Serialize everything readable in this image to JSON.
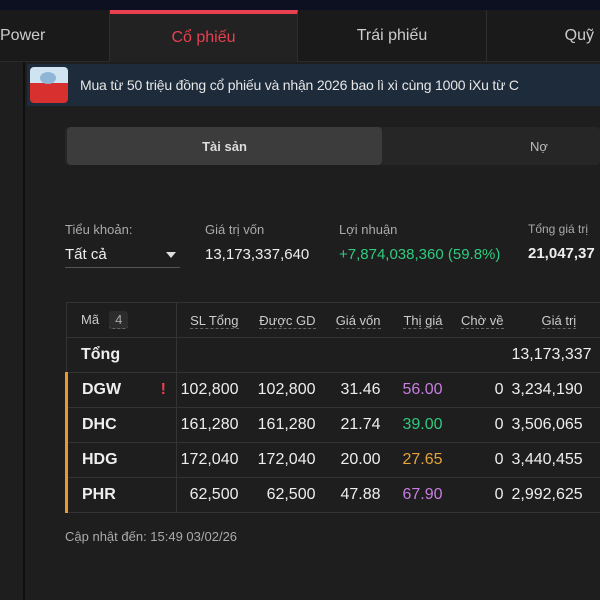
{
  "tabs": [
    "Power",
    "Cổ phiếu",
    "Trái phiếu",
    "Quỹ"
  ],
  "banner": "Mua từ 50 triệu đồng cổ phiếu và nhận 2026 bao lì xì cùng 1000 iXu từ C",
  "segment": {
    "assets": "Tài sản",
    "debt": "Nợ"
  },
  "summary": {
    "subaccount_label": "Tiểu khoản:",
    "subaccount_value": "Tất cả",
    "cost_label": "Giá trị vốn",
    "cost_value": "13,173,337,640",
    "profit_label": "Lợi nhuận",
    "profit_value": "+7,874,038,360 (59.8%)",
    "total_label": "Tổng giá trị",
    "total_value": "21,047,37"
  },
  "table": {
    "headers": [
      "Mã",
      "SL Tổng",
      "Được GD",
      "Giá vốn",
      "Thị giá",
      "Chờ về",
      "Giá trị"
    ],
    "count": "4",
    "total_label": "Tổng",
    "total_value": "13,173,337",
    "rows": [
      {
        "sym": "DGW",
        "warn": "!",
        "qty": "102,800",
        "avail": "102,800",
        "cost": "31.46",
        "price": "56.00",
        "color": "#c77ee0",
        "pending": "0",
        "value": "3,234,190"
      },
      {
        "sym": "DHC",
        "warn": "",
        "qty": "161,280",
        "avail": "161,280",
        "cost": "21.74",
        "price": "39.00",
        "color": "#2fcb7e",
        "pending": "0",
        "value": "3,506,065"
      },
      {
        "sym": "HDG",
        "warn": "",
        "qty": "172,040",
        "avail": "172,040",
        "cost": "20.00",
        "price": "27.65",
        "color": "#e8a23a",
        "pending": "0",
        "value": "3,440,455"
      },
      {
        "sym": "PHR",
        "warn": "",
        "qty": "62,500",
        "avail": "62,500",
        "cost": "47.88",
        "price": "67.90",
        "color": "#c77ee0",
        "pending": "0",
        "value": "2,992,625"
      }
    ]
  },
  "footer": "Cập nhật đến: 15:49 03/02/26"
}
